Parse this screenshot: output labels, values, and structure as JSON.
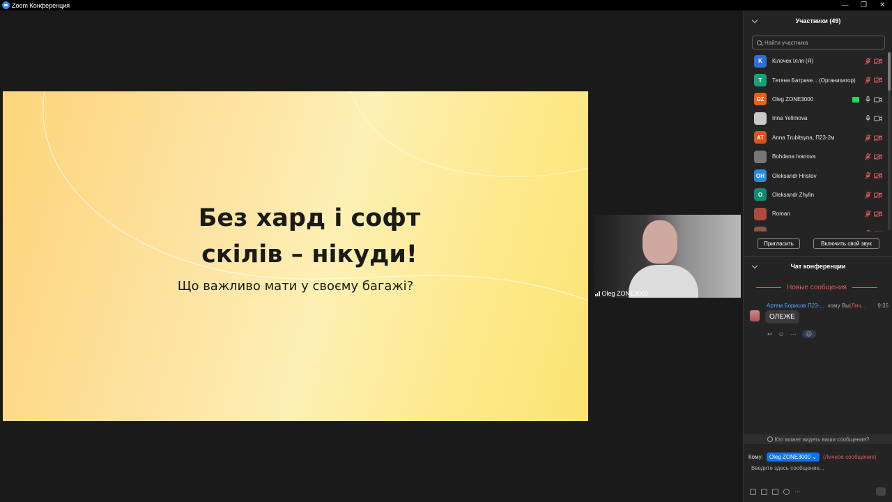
{
  "window": {
    "title": "Zoom Конференция",
    "controls": [
      "—",
      "❐",
      "✕"
    ]
  },
  "slide": {
    "title_line1": "Без хард і софт",
    "title_line2": "скілів – нікуди!",
    "subtitle": "Що важливо мати у своєму багажі?"
  },
  "video": {
    "name": "Oleg ZONE3000"
  },
  "participants": {
    "header": "Участники (49)",
    "search_placeholder": "Найти участника",
    "list": [
      {
        "initials": "K",
        "name": "Кілочек Ілля (Я)",
        "color": "#2f6fd6",
        "mic": "muted",
        "cam": "off"
      },
      {
        "initials": "T",
        "name": "Тетяна Батраче... (Организатор)",
        "color": "#17a37a",
        "mic": "muted",
        "cam": "off"
      },
      {
        "initials": "OZ",
        "name": "Oleg ZONE3000",
        "color": "#e5621a",
        "mic": "on",
        "cam": "on",
        "sharing": true
      },
      {
        "initials": "",
        "name": "Inna Yefimova",
        "color": "#c9c9c9",
        "mic": "on",
        "cam": "on"
      },
      {
        "initials": "AT",
        "name": "Anna Trubitsyna, П23-2м",
        "color": "#d9541c",
        "mic": "muted",
        "cam": "off"
      },
      {
        "initials": "",
        "name": "Bohdana Ivanova",
        "color": "#777777",
        "mic": "muted",
        "cam": "off"
      },
      {
        "initials": "OH",
        "name": "Oleksandr Hristov",
        "color": "#2b8ad6",
        "mic": "muted",
        "cam": "off"
      },
      {
        "initials": "O",
        "name": "Oleksandr Zhylin",
        "color": "#138a77",
        "mic": "muted",
        "cam": "off"
      },
      {
        "initials": "",
        "name": "Roman",
        "color": "#b04a3a",
        "mic": "muted",
        "cam": "off"
      },
      {
        "initials": "",
        "name": "",
        "color": "#885544",
        "mic": "muted",
        "cam": "off"
      }
    ],
    "invite_label": "Пригласить",
    "unmute_label": "Включить свой звук"
  },
  "chat": {
    "header": "Чат конференции",
    "new_messages": "Новые сообщения",
    "message": {
      "sender": "Артем Борисов П23-...",
      "to": "кому Вы",
      "private": "(Лич...",
      "time": "9:35",
      "text": "ОЛЕЖЕ",
      "reaction": "😄"
    },
    "who_can_see": "Кто может видеть ваши сообщения?",
    "to_label": "Кому:",
    "recipient": "Oleg ZONE3000",
    "recipient_note": "(Личное сообщение)",
    "input_placeholder": "Введите здесь сообщение..."
  },
  "colors": {
    "accent": "#0e72ed",
    "alert": "#e05a5a",
    "link": "#5aa7ff"
  }
}
